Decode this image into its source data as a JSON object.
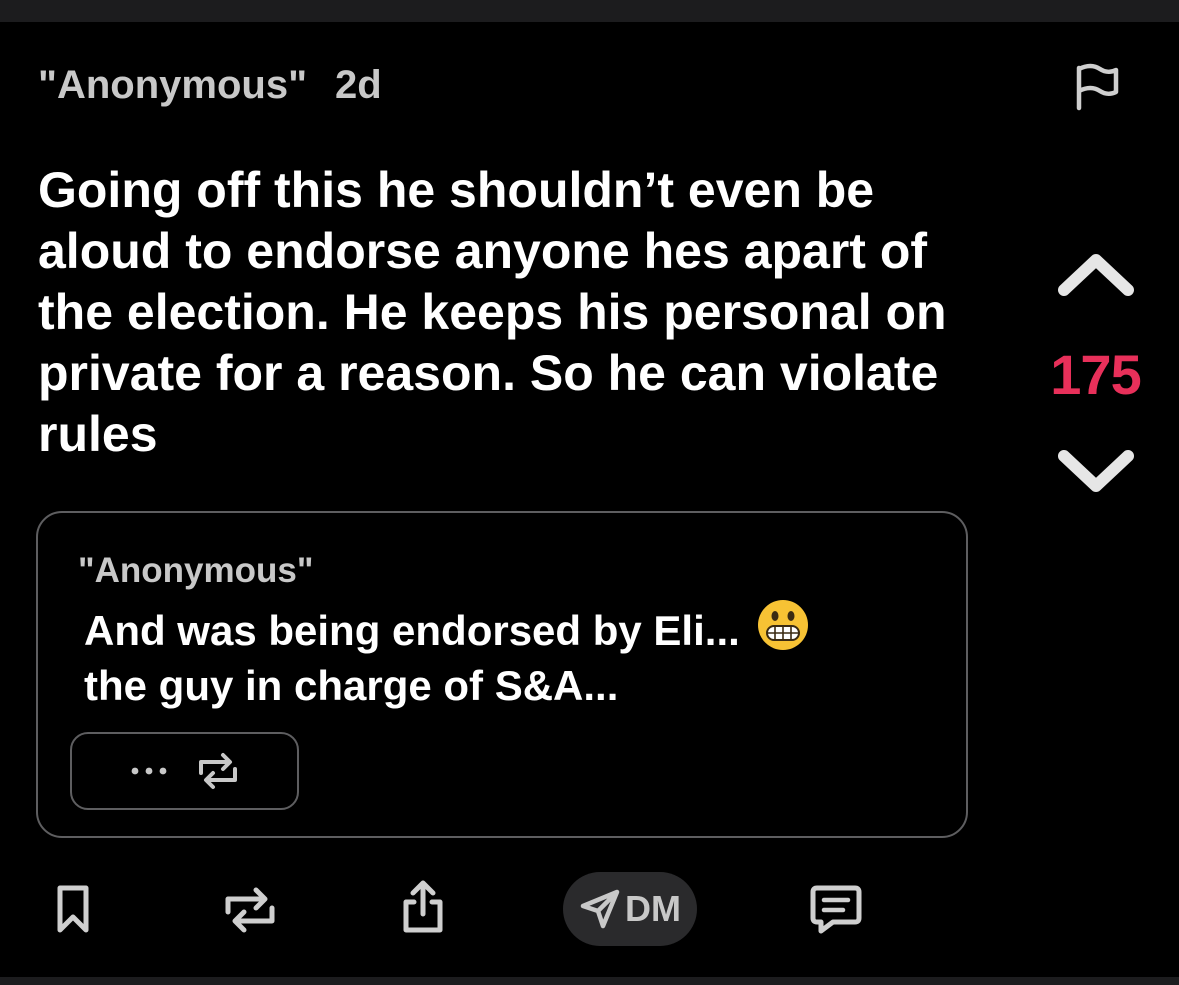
{
  "post": {
    "author": "\"Anonymous\"",
    "age": "2d",
    "text": "Going off this he shouldn’t even be aloud to endorse anyone hes apart of the election. He keeps his personal on private for a reason. So he can violate rules"
  },
  "vote": {
    "score": "175",
    "score_color": "#e8305a"
  },
  "quoted": {
    "author": "\"Anonymous\"",
    "line1": "And was being endorsed by Eli...",
    "line2": "the guy in charge of S&A...",
    "emoji": "grimacing-face"
  },
  "actions": {
    "dm_label": "DM",
    "icons": [
      "bookmark-icon",
      "repost-icon",
      "share-icon",
      "dm-send-icon",
      "comment-icon"
    ]
  },
  "theme": {
    "background": "#000000",
    "accent": "#e8305a",
    "muted_text": "#c8c8c8",
    "border": "#5e5e60"
  }
}
